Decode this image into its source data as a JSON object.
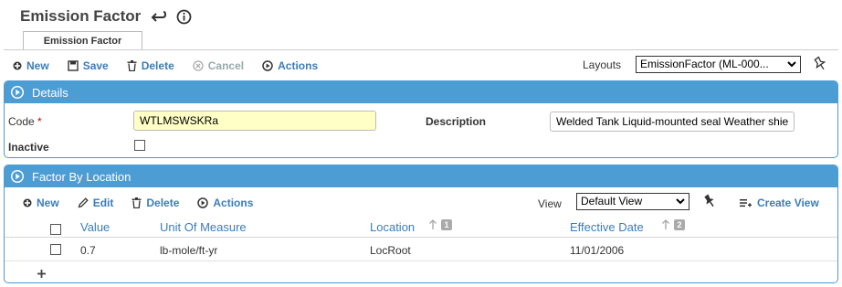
{
  "page": {
    "title": "Emission Factor"
  },
  "tabs": [
    {
      "label": "Emission Factor"
    }
  ],
  "toolbar": {
    "new_label": "New",
    "save_label": "Save",
    "delete_label": "Delete",
    "cancel_label": "Cancel",
    "actions_label": "Actions"
  },
  "layouts": {
    "label": "Layouts",
    "selected": "EmissionFactor (ML-000..."
  },
  "details": {
    "header": "Details",
    "code_label": "Code",
    "code_required": "*",
    "code_value": "WTLMSWSKRa",
    "description_label": "Description",
    "description_value": "Welded Tank Liquid-mounted seal Weather shie",
    "inactive_label": "Inactive",
    "inactive_checked": false
  },
  "factor_by_location": {
    "header": "Factor By Location",
    "toolbar": {
      "new_label": "New",
      "edit_label": "Edit",
      "delete_label": "Delete",
      "actions_label": "Actions"
    },
    "view_label": "View",
    "view_selected": "Default View",
    "create_view_label": "Create View",
    "columns": [
      {
        "label": "Value"
      },
      {
        "label": "Unit Of Measure"
      },
      {
        "label": "Location",
        "sort_order": "1"
      },
      {
        "label": "Effective Date",
        "sort_order": "2"
      }
    ],
    "rows": [
      {
        "value": "0.7",
        "unit": "lb-mole/ft-yr",
        "location": "LocRoot",
        "effective_date": "11/01/2006"
      }
    ]
  },
  "colors": {
    "accent": "#3b7db8",
    "panel_header": "#4d9dd5",
    "required": "#cc0000",
    "highlight_input": "#ffffc6"
  }
}
